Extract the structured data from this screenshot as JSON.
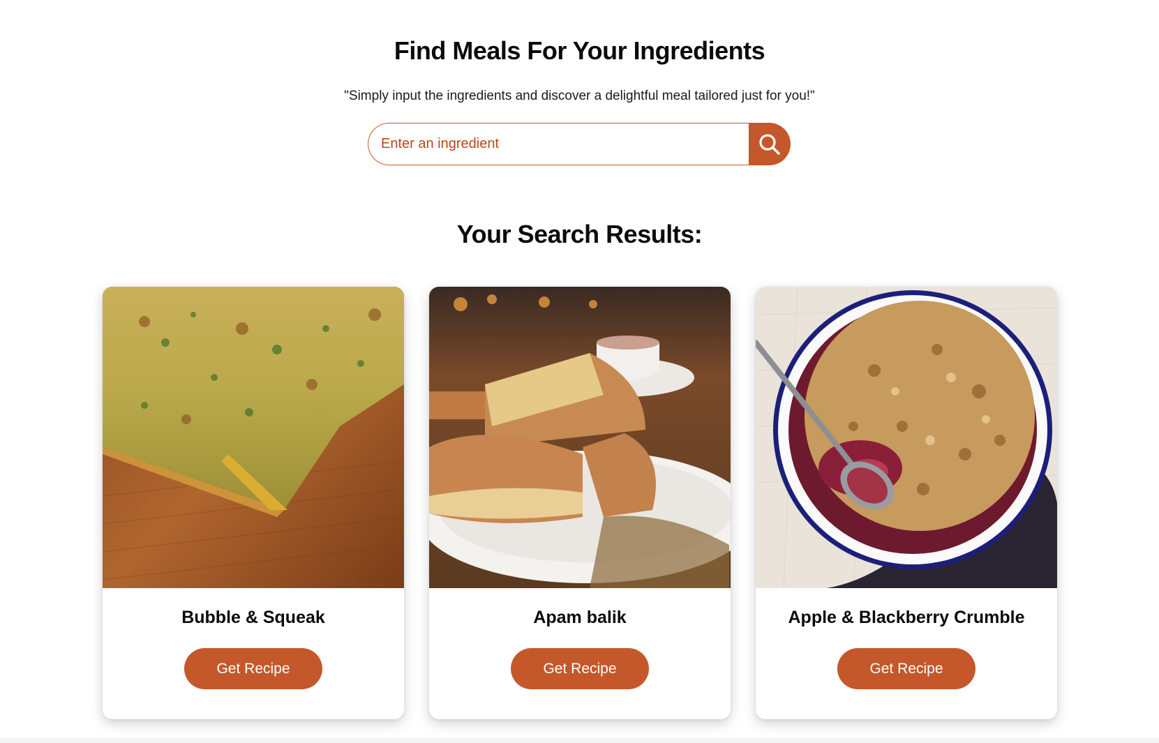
{
  "header": {
    "title": "Find Meals For Your Ingredients",
    "subtitle": "\"Simply input the ingredients and discover a delightful meal tailored just for you!\""
  },
  "search": {
    "placeholder": "Enter an ingredient",
    "value": "",
    "button_icon": "search-icon"
  },
  "results": {
    "heading": "Your Search Results:",
    "meals": [
      {
        "name": "Bubble & Squeak",
        "button_label": "Get Recipe",
        "image": "bubble-and-squeak-photo"
      },
      {
        "name": "Apam balik",
        "button_label": "Get Recipe",
        "image": "apam-balik-photo"
      },
      {
        "name": "Apple & Blackberry Crumble",
        "button_label": "Get Recipe",
        "image": "apple-blackberry-crumble-photo"
      }
    ]
  },
  "colors": {
    "accent": "#c4582a",
    "text": "#0b0b0b",
    "background": "#ffffff"
  }
}
